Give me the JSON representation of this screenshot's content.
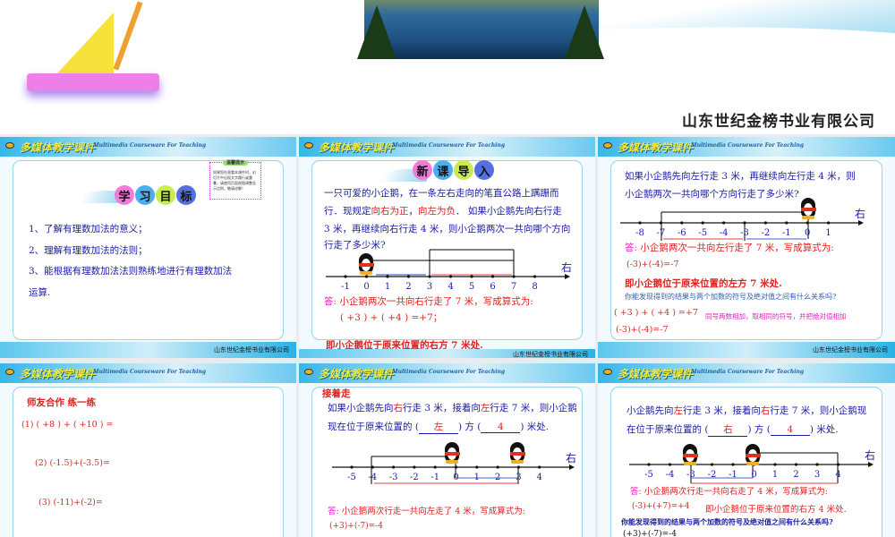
{
  "banner": {
    "company": "山东世纪金榜书业有限公司"
  },
  "common": {
    "logo": "多媒体教学课件",
    "subtitle": "Multimedia Courseware For Teaching",
    "footer": "山东世纪金榜书业有限公司"
  },
  "slides": [
    {
      "badge": [
        "学",
        "习",
        "目",
        "标"
      ],
      "tip": {
        "title": "温馨提示",
        "body": "如果您在观看本课件时，幻灯片中出现文字跳行或重叠，请使用页面视图调整显示比例，敬请谅解！"
      },
      "lines": [
        "1、了解有理数加法的意义；",
        "2、理解有理数加法的法则；",
        "3、能根据有理数加法法则熟练地进行有理数加法",
        "运算."
      ]
    },
    {
      "badge": [
        "新",
        "课",
        "导",
        "入"
      ],
      "p1": "一只可爱的小企鹅，在一条左右走向的笔直公路上蹒跚而",
      "p2a": "行．现规定",
      "p2b": "向右为正",
      "p2c": "，",
      "p2d": "向左为负",
      "p2e": "．  如果小企鹅先向右行走",
      "p3": "3 米，再继续向右行走 4 米，则小企鹅两次一共向哪个方向",
      "p4": "行走了多少米?",
      "numberline": {
        "labels": [
          "-1",
          "0",
          "1",
          "2",
          "3",
          "4",
          "5",
          "6",
          "7",
          "8"
        ],
        "direction": "右"
      },
      "answer_prefix": "答:",
      "answer": " 小企鹅两次一共向右行走了 7 米，写成算式为:",
      "equation": "( +3 ) + ( +4 ) =+7；",
      "conclusion": "即小企鹅位于原来位置的右方 7 米处."
    },
    {
      "p1": "如果小企鹅先向左行走 3 米，再继续向左行走 4 米，则",
      "p2": "小企鹅两次一共向哪个方向行走了多少米?",
      "numberline": {
        "labels": [
          "-8",
          "-7",
          "-6",
          "-5",
          "-4",
          "-3",
          "-2",
          "-1",
          "0",
          "1"
        ],
        "direction": "右"
      },
      "answer_prefix": "答:",
      "answer": " 小企鹅两次一共向左行走了 7 米，写成算式为:",
      "equation": "(-3)+(-4)=-7",
      "conclusion": "即小企鹅位于原来位置的左方 7 米处.",
      "question": "你能发现得到的结果与两个加数的符号及绝对值之间有什么关系吗?",
      "eq1": "( +3 ) + ( +4 ) =+7",
      "rule": "同号两数相加，取相同的符号，并把绝对值相加",
      "eq2": "(-3)+(-4)=-7"
    },
    {
      "title": "师友合作  练一练",
      "items": [
        "(1) ( +8 ) + ( +10 ) =",
        "(2)  (-1.5)+(-3.5)=",
        "(3)  (-11)+(-2)="
      ]
    },
    {
      "heading": "接着走",
      "p1a": "如果小企鹅先向",
      "p1b": "右",
      "p1c": "行走 3 米，接着向",
      "p1d": "左",
      "p1e": "行走 7 米，则小企鹅",
      "p2a": "现在位于原来位置的 (",
      "p2_blank1": "左",
      "p2b": ") 方 (",
      "p2_blank2": "4",
      "p2c": ") 米处.",
      "numberline": {
        "labels": [
          "-5",
          "-4",
          "-3",
          "-2",
          "-1",
          "0",
          "1",
          "2",
          "3",
          "4"
        ],
        "direction": "右"
      },
      "answer_prefix": "答:",
      "answer": " 小企鹅两次行走一共向左走了 4 米，写成算式为:",
      "equation": "(+3)+(-7)=-4"
    },
    {
      "p1a": "小企鹅先向",
      "p1b": "左",
      "p1c": "行走 3 米，接着向",
      "p1d": "右",
      "p1e": "行走 7 米，则小企鹅现",
      "p2a": "在位于原来位置的 (",
      "p2_blank1": "右",
      "p2b": ") 方 (",
      "p2_blank2": "4",
      "p2c": ") 米处.",
      "numberline": {
        "labels": [
          "-5",
          "-4",
          "-3",
          "-2",
          "-1",
          "0",
          "1",
          "2",
          "3",
          "4"
        ],
        "direction": "右"
      },
      "answer_prefix": "答:",
      "answer": " 小企鹅两次行走一共向右走了 4 米，写成算式为:",
      "equation": "(-3)+(+7)=+4",
      "conclusion": "即小企鹅位于原来位置的右方 4 米处.",
      "question": "你能发现得到的结果与两个加数的符号及绝对值之间有什么关系吗?",
      "eq1": "(+3)+(-7)=-4"
    }
  ]
}
